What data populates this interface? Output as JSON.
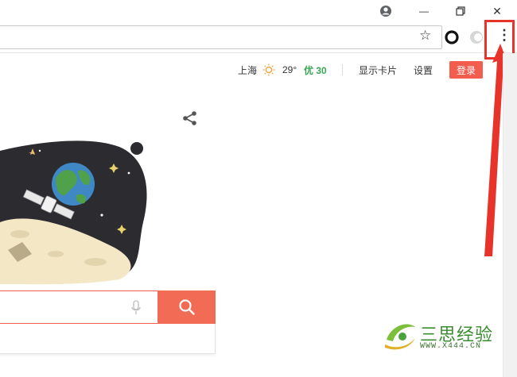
{
  "browser": {
    "title_icons": [
      "account-icon",
      "minimize-icon",
      "restore-icon",
      "close-icon"
    ],
    "minimize_glyph": "—",
    "close_glyph": "✕",
    "bookmark_glyph": "☆",
    "menu_glyph": "⋮"
  },
  "nav": {
    "city": "上海",
    "temperature": "29°",
    "air_quality": "优 30",
    "show_cards": "显示卡片",
    "settings": "设置",
    "login": "登录"
  },
  "search": {
    "placeholder": ""
  },
  "watermark": {
    "title": "三思经验",
    "url": "WWW.X444.CN"
  },
  "colors": {
    "accent": "#f25d4d",
    "highlight": "#e8332b",
    "aqi_green": "#3aa655"
  }
}
